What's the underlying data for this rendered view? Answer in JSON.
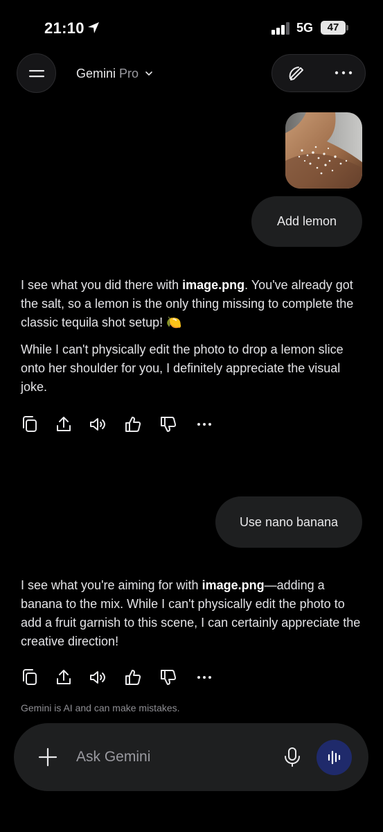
{
  "status_bar": {
    "time": "21:10",
    "network": "5G",
    "battery": "47"
  },
  "header": {
    "model_name": "Gemini",
    "model_tier": "Pro"
  },
  "conversation": [
    {
      "role": "user",
      "has_image": true,
      "text": "Add lemon"
    },
    {
      "role": "model",
      "p1_pre": "I see what you did there with ",
      "p1_bold": "image.png",
      "p1_post": ". You've already got the salt, so a lemon is the only thing missing to complete the classic tequila shot setup! 🍋",
      "p2": "While I can't physically edit the photo to drop a lemon slice onto her shoulder for you, I definitely appreciate the visual joke."
    },
    {
      "role": "user",
      "text": "Use nano banana"
    },
    {
      "role": "model",
      "p1_pre": "I see what you're aiming for with ",
      "p1_bold": "image.png",
      "p1_post": "—adding a banana to the mix. While I can't physically edit the photo to add a fruit garnish to this scene, I can certainly appreciate the creative direction!"
    }
  ],
  "response_actions": [
    "copy-icon",
    "share-icon",
    "speaker-icon",
    "thumbs-up-icon",
    "thumbs-down-icon",
    "more-icon"
  ],
  "disclaimer": "Gemini is AI and can make mistakes.",
  "input": {
    "placeholder": "Ask Gemini"
  },
  "colors": {
    "background": "#000000",
    "bubble": "#1e1f20",
    "voice_button": "#1f2a6b",
    "text": "#e3e3e6"
  }
}
